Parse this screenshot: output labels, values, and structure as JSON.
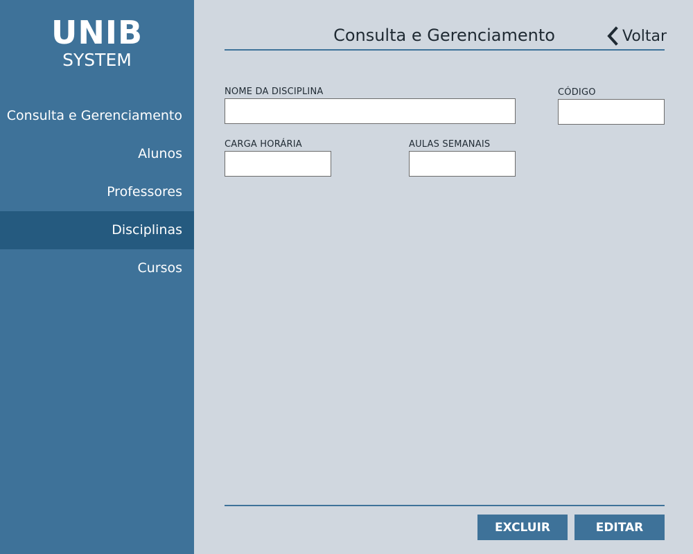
{
  "brand": {
    "name": "UNIB",
    "subtitle": "SYSTEM"
  },
  "sidebar": {
    "items": [
      {
        "label": "Consulta e Gerenciamento",
        "active": false
      },
      {
        "label": "Alunos",
        "active": false
      },
      {
        "label": "Professores",
        "active": false
      },
      {
        "label": "Disciplinas",
        "active": true
      },
      {
        "label": "Cursos",
        "active": false
      }
    ]
  },
  "header": {
    "title": "Consulta e Gerenciamento",
    "back_label": "Voltar",
    "back_icon": "chevron-left-icon"
  },
  "form": {
    "nome_disciplina": {
      "label": "NOME DA DISCIPLINA",
      "value": ""
    },
    "codigo": {
      "label": "CÓDIGO",
      "value": ""
    },
    "carga_horaria": {
      "label": "CARGA HORÁRIA",
      "value": ""
    },
    "aulas_semanais": {
      "label": "AULAS SEMANAIS",
      "value": ""
    }
  },
  "actions": {
    "delete_label": "EXCLUIR",
    "edit_label": "EDITAR"
  },
  "colors": {
    "sidebar_bg": "#3e7299",
    "sidebar_active_bg": "#255a7f",
    "main_bg": "#d0d7df",
    "accent": "#3e7299"
  }
}
